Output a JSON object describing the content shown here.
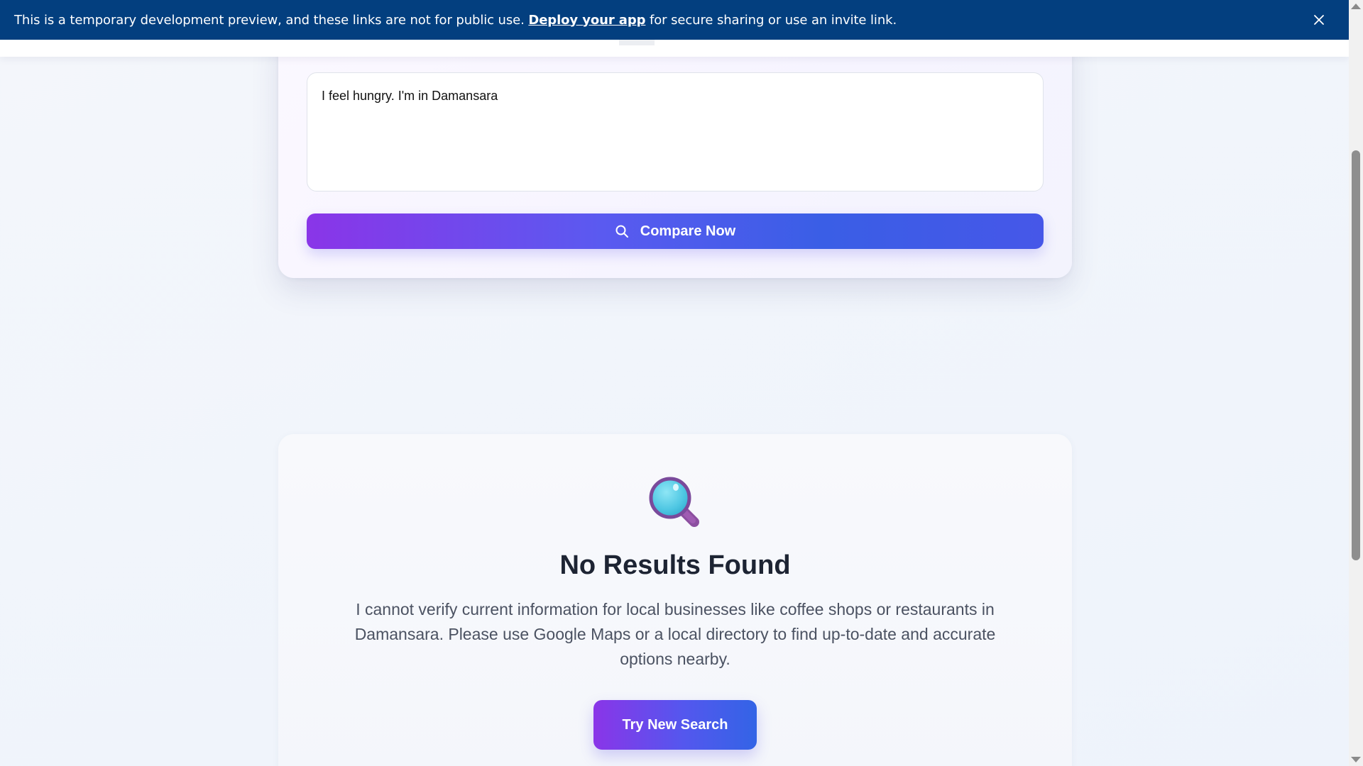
{
  "banner": {
    "message_before": "This is a temporary development preview, and these links are not for public use.",
    "link_text": "Deploy your app",
    "message_after": "for secure sharing or use an invite link.",
    "close_icon": "close-icon",
    "background_color": "#033f7f"
  },
  "search": {
    "query_value": "I feel hungry. I'm in Damansara",
    "button_label": "Compare Now",
    "button_icon": "search-icon"
  },
  "results": {
    "icon": "magnifying-glass-icon",
    "title": "No Results Found",
    "message": "I cannot verify current information for local businesses like coffee shops or restaurants in Damansara. Please use Google Maps or a local directory to find up-to-date and accurate options nearby.",
    "button_label": "Try New Search"
  },
  "colors": {
    "accent_start": "#8a35e8",
    "accent_end": "#3a5ee6",
    "title_text": "#1d2433",
    "body_text": "#4b5262"
  }
}
